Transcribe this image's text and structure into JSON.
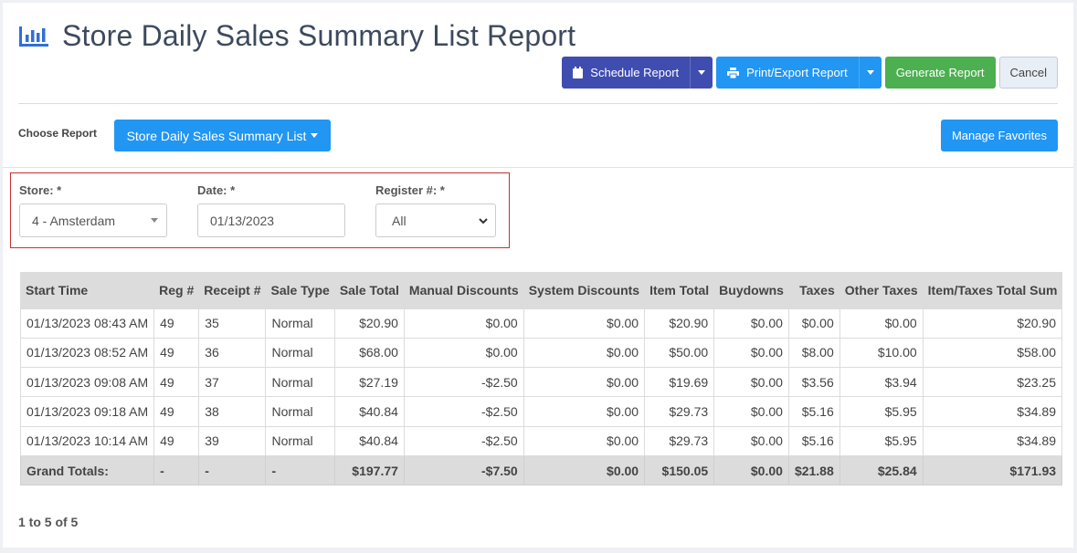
{
  "header": {
    "title": "Store Daily Sales Summary List Report",
    "icon": "bar-chart-icon"
  },
  "toolbar": {
    "schedule_label": "Schedule Report",
    "print_label": "Print/Export Report",
    "generate_label": "Generate Report",
    "cancel_label": "Cancel"
  },
  "chooser": {
    "label": "Choose Report",
    "selected": "Store Daily Sales Summary List",
    "manage_label": "Manage Favorites"
  },
  "filters": {
    "store_label": "Store: *",
    "store_value": "4 - Amsterdam",
    "date_label": "Date: *",
    "date_value": "01/13/2023",
    "register_label": "Register #: *",
    "register_value": "All"
  },
  "table": {
    "columns": [
      "Start Time",
      "Reg #",
      "Receipt #",
      "Sale Type",
      "Sale Total",
      "Manual Discounts",
      "System Discounts",
      "Item Total",
      "Buydowns",
      "Taxes",
      "Other Taxes",
      "Item/Taxes Total Sum"
    ],
    "rows": [
      [
        "01/13/2023 08:43 AM",
        "49",
        "35",
        "Normal",
        "$20.90",
        "$0.00",
        "$0.00",
        "$20.90",
        "$0.00",
        "$0.00",
        "$0.00",
        "$20.90"
      ],
      [
        "01/13/2023 08:52 AM",
        "49",
        "36",
        "Normal",
        "$68.00",
        "$0.00",
        "$0.00",
        "$50.00",
        "$0.00",
        "$8.00",
        "$10.00",
        "$58.00"
      ],
      [
        "01/13/2023 09:08 AM",
        "49",
        "37",
        "Normal",
        "$27.19",
        "-$2.50",
        "$0.00",
        "$19.69",
        "$0.00",
        "$3.56",
        "$3.94",
        "$23.25"
      ],
      [
        "01/13/2023 09:18 AM",
        "49",
        "38",
        "Normal",
        "$40.84",
        "-$2.50",
        "$0.00",
        "$29.73",
        "$0.00",
        "$5.16",
        "$5.95",
        "$34.89"
      ],
      [
        "01/13/2023 10:14 AM",
        "49",
        "39",
        "Normal",
        "$40.84",
        "-$2.50",
        "$0.00",
        "$29.73",
        "$0.00",
        "$5.16",
        "$5.95",
        "$34.89"
      ]
    ],
    "totals": [
      "Grand Totals:",
      "-",
      "-",
      "-",
      "$197.77",
      "-$7.50",
      "$0.00",
      "$150.05",
      "$0.00",
      "$21.88",
      "$25.84",
      "$171.93"
    ]
  },
  "pager": {
    "text": "1 to 5 of 5"
  }
}
